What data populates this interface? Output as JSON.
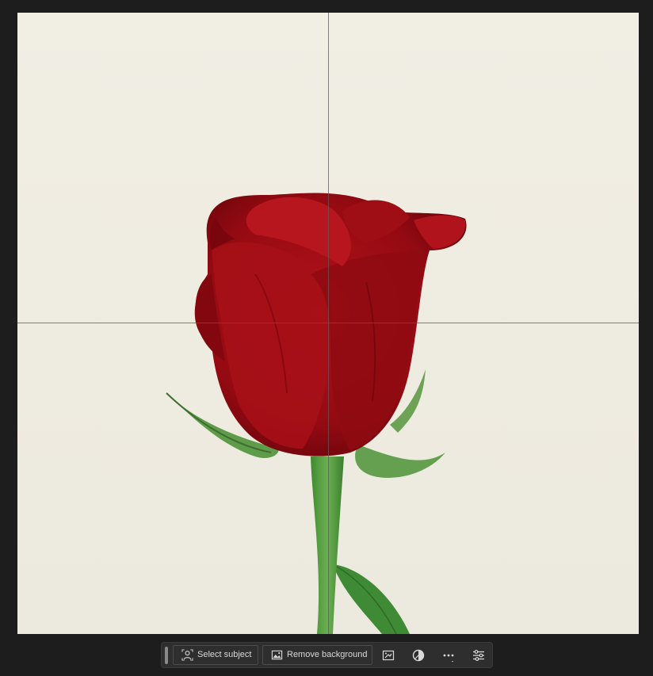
{
  "canvas": {
    "background_color": "#efece2",
    "content": "rose-photo"
  },
  "taskbar": {
    "select_subject_label": "Select subject",
    "remove_background_label": "Remove background",
    "icons": [
      "select-subject-icon",
      "image-icon",
      "transform-icon",
      "adjustment-icon",
      "more-options-icon",
      "properties-icon"
    ]
  },
  "colors": {
    "workspace": "#1d1d1d",
    "taskbar": "#2e2e2e",
    "text": "#d9d9d9",
    "rose": "#9e0c13",
    "stem": "#4f9a3c"
  }
}
